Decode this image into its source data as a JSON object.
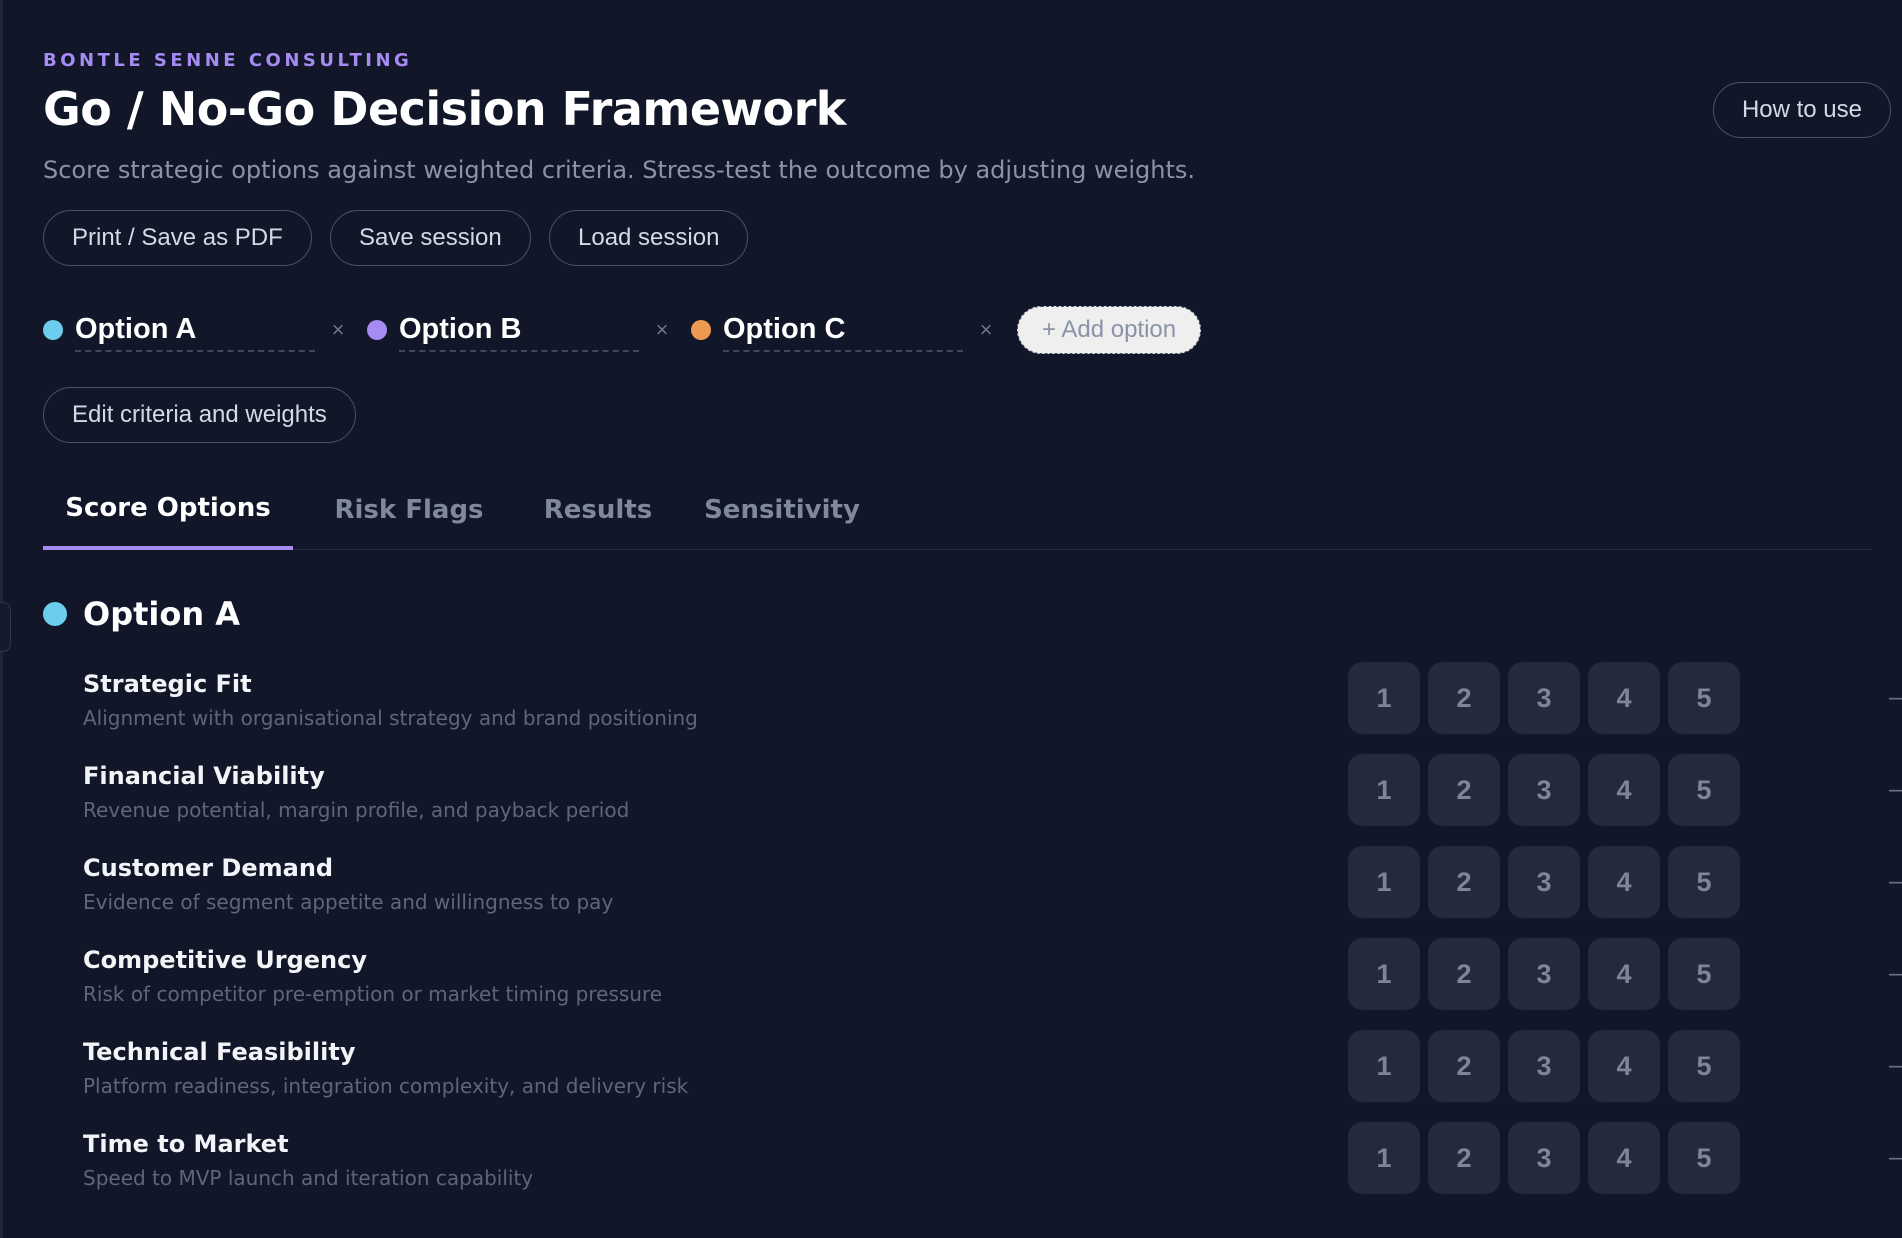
{
  "header": {
    "eyebrow": "BONTLE SENNE CONSULTING",
    "title": "Go / No-Go Decision Framework",
    "subtitle": "Score strategic options against weighted criteria. Stress-test the outcome by adjusting weights.",
    "how_to_use": "How to use"
  },
  "actions": {
    "print": "Print / Save as PDF",
    "save": "Save session",
    "load": "Load session"
  },
  "options": [
    {
      "name": "Option A",
      "color": "#6ccdec",
      "remove": "×"
    },
    {
      "name": "Option B",
      "color": "#a58bf2",
      "remove": "×"
    },
    {
      "name": "Option C",
      "color": "#ec9a52",
      "remove": "×"
    }
  ],
  "add_option": "+ Add option",
  "edit_criteria": "Edit criteria and weights",
  "tabs": [
    {
      "label": "Score Options",
      "active": true
    },
    {
      "label": "Risk Flags",
      "active": false
    },
    {
      "label": "Results",
      "active": false
    },
    {
      "label": "Sensitivity",
      "active": false
    }
  ],
  "section": {
    "title": "Option A",
    "color": "#6ccdec"
  },
  "score_scale": [
    "1",
    "2",
    "3",
    "4",
    "5"
  ],
  "criteria": [
    {
      "name": "Strategic Fit",
      "description": "Alignment with organisational strategy and brand positioning",
      "score": "—"
    },
    {
      "name": "Financial Viability",
      "description": "Revenue potential, margin profile, and payback period",
      "score": "—"
    },
    {
      "name": "Customer Demand",
      "description": "Evidence of segment appetite and willingness to pay",
      "score": "—"
    },
    {
      "name": "Competitive Urgency",
      "description": "Risk of competitor pre-emption or market timing pressure",
      "score": "—"
    },
    {
      "name": "Technical Feasibility",
      "description": "Platform readiness, integration complexity, and delivery risk",
      "score": "—"
    },
    {
      "name": "Time to Market",
      "description": "Speed to MVP launch and iteration capability",
      "score": "—"
    }
  ]
}
